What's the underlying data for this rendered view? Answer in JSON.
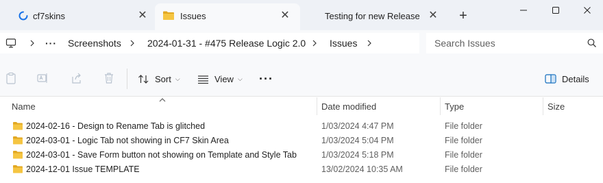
{
  "tabs": [
    {
      "label": "cf7skins",
      "icon": "loading-icon",
      "active": false
    },
    {
      "label": "Issues",
      "icon": "folder-icon",
      "active": true
    },
    {
      "label": "Testing for new Release",
      "icon": "",
      "active": false
    }
  ],
  "new_tab_symbol": "+",
  "window_controls": [
    "minimize",
    "maximize",
    "close"
  ],
  "address": {
    "overflow_label": "···",
    "breadcrumbs": [
      "Screenshots",
      "2024-01-31 - #475 Release Logic 2.0",
      "Issues"
    ]
  },
  "search": {
    "placeholder": "Search Issues"
  },
  "commands": {
    "sort_label": "Sort",
    "view_label": "View",
    "more_label": "···",
    "details_label": "Details"
  },
  "columns": [
    "Name",
    "Date modified",
    "Type",
    "Size"
  ],
  "files": [
    {
      "name": "2024-02-16 - Design to Rename Tab is glitched",
      "date": "1/03/2024 4:47 PM",
      "type": "File folder",
      "size": ""
    },
    {
      "name": "2024-03-01 - Logic Tab not showing in CF7 Skin Area",
      "date": "1/03/2024 5:04 PM",
      "type": "File folder",
      "size": ""
    },
    {
      "name": "2024-03-01 - Save Form button not showing on Template and Style Tab",
      "date": "1/03/2024 5:18 PM",
      "type": "File folder",
      "size": ""
    },
    {
      "name": "2024-12-01 Issue TEMPLATE",
      "date": "13/02/2024 10:35 AM",
      "type": "File folder",
      "size": ""
    }
  ],
  "colors": {
    "folder": "#f5c542",
    "folder_dark": "#e2a823",
    "loading_spinner": "#1a73e8",
    "titlebar_bg": "#eef1f6",
    "surface_bg": "#f8f9fb",
    "details_accent": "#0f6cbd"
  }
}
